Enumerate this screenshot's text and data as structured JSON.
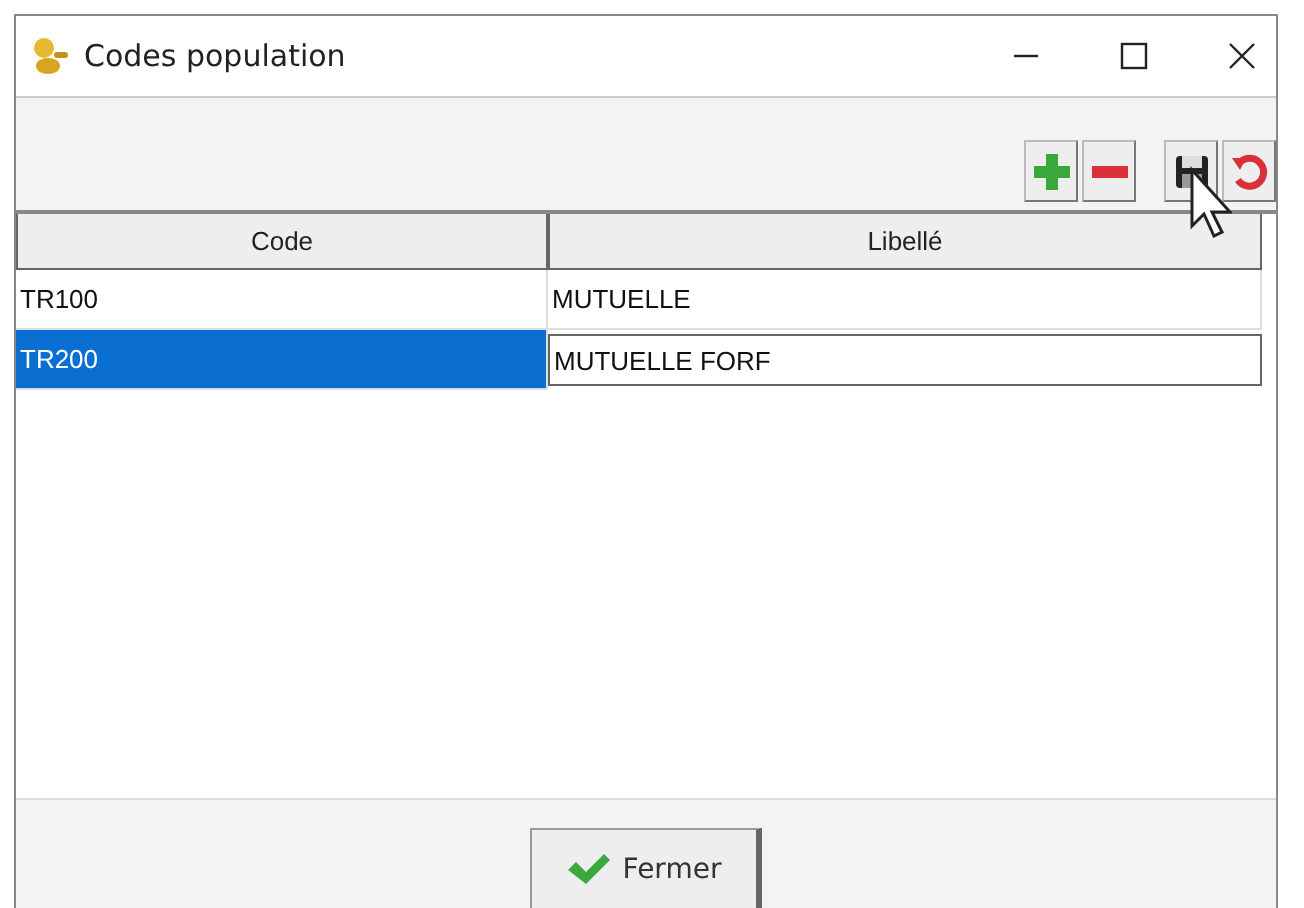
{
  "window": {
    "title": "Codes population"
  },
  "toolbar": {
    "buttons": [
      {
        "kind": "add"
      },
      {
        "kind": "remove"
      },
      {
        "kind": "save"
      },
      {
        "kind": "undo"
      }
    ]
  },
  "table": {
    "columns": [
      "Code",
      "Libellé"
    ],
    "rows": [
      {
        "code": "TR100",
        "label": "MUTUELLE",
        "selected": false,
        "editing": false
      },
      {
        "code": "TR200",
        "label": "MUTUELLE FORF",
        "selected": true,
        "editing": true
      }
    ]
  },
  "footer": {
    "close_button": "Fermer"
  }
}
